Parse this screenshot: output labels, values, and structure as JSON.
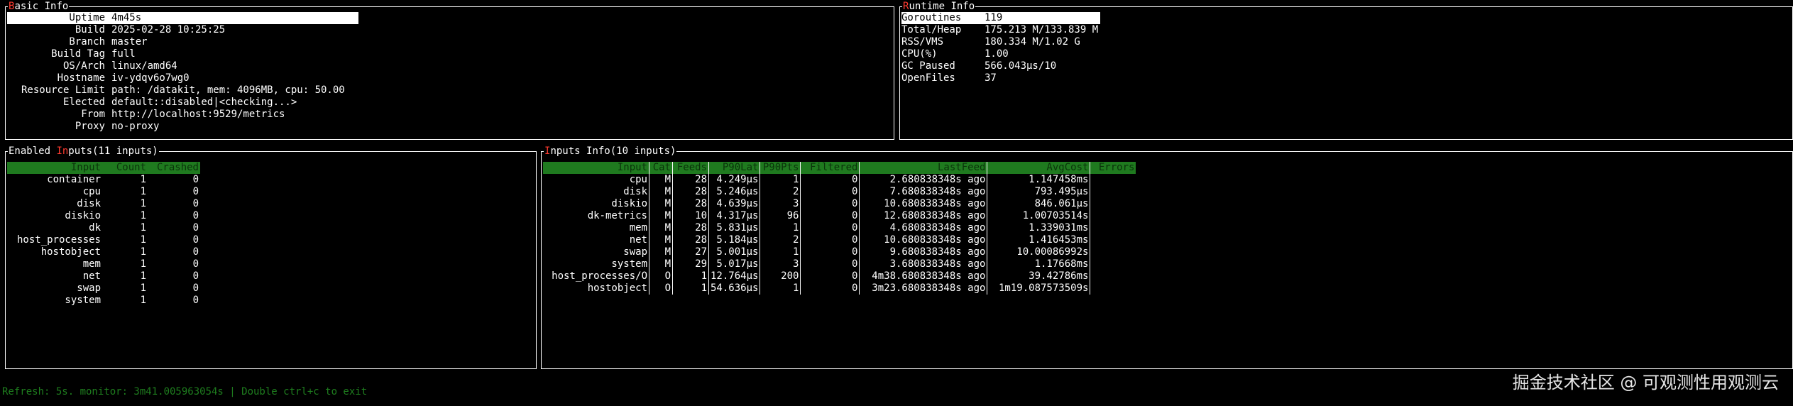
{
  "basic_info": {
    "title_hl": "B",
    "title_rest": "asic Info",
    "rows": [
      {
        "key": "Uptime",
        "value": "4m45s"
      },
      {
        "key": "Build",
        "value": "2025-02-28 10:25:25"
      },
      {
        "key": "Branch",
        "value": "master"
      },
      {
        "key": "Build Tag",
        "value": "full"
      },
      {
        "key": "OS/Arch",
        "value": "linux/amd64"
      },
      {
        "key": "Hostname",
        "value": "iv-ydqv6o7wg0"
      },
      {
        "key": "Resource Limit",
        "value": "path: /datakit, mem: 4096MB, cpu: 50.00"
      },
      {
        "key": "Elected",
        "value": "default::disabled|<checking...>"
      },
      {
        "key": "From",
        "value": "http://localhost:9529/metrics"
      },
      {
        "key": "Proxy",
        "value": "no-proxy"
      }
    ]
  },
  "runtime_info": {
    "title_hl": "R",
    "title_rest": "untime Info",
    "rows": [
      {
        "key": "Goroutines",
        "value": "119"
      },
      {
        "key": "Total/Heap",
        "value": "175.213 M/133.839 M"
      },
      {
        "key": "RSS/VMS",
        "value": "180.334 M/1.02 G"
      },
      {
        "key": "CPU(%)",
        "value": "1.00"
      },
      {
        "key": "GC Paused",
        "value": "566.043µs/10"
      },
      {
        "key": "OpenFiles",
        "value": "37"
      }
    ]
  },
  "enabled_inputs": {
    "title_a": "Enabled ",
    "title_hl": "In",
    "title_b": "puts(11 inputs)",
    "headers": [
      "Input",
      "Count",
      "Crashed"
    ],
    "rows": [
      [
        "container",
        "1",
        "0"
      ],
      [
        "cpu",
        "1",
        "0"
      ],
      [
        "disk",
        "1",
        "0"
      ],
      [
        "diskio",
        "1",
        "0"
      ],
      [
        "dk",
        "1",
        "0"
      ],
      [
        "host_processes",
        "1",
        "0"
      ],
      [
        "hostobject",
        "1",
        "0"
      ],
      [
        "mem",
        "1",
        "0"
      ],
      [
        "net",
        "1",
        "0"
      ],
      [
        "swap",
        "1",
        "0"
      ],
      [
        "system",
        "1",
        "0"
      ]
    ]
  },
  "inputs_info": {
    "title_hl": "I",
    "title_rest": "nputs Info(10 inputs)",
    "headers": [
      "Input",
      "Cat",
      "Feeds",
      "P90Lat",
      "P90Pts",
      "Filtered",
      "LastFeed",
      "AvgCost",
      "Errors"
    ],
    "rows": [
      [
        "cpu",
        "M",
        "28",
        "4.249µs",
        "1",
        "0",
        "2.680838348s ago",
        "1.147458ms",
        ""
      ],
      [
        "disk",
        "M",
        "28",
        "5.246µs",
        "2",
        "0",
        "7.680838348s ago",
        "793.495µs",
        ""
      ],
      [
        "diskio",
        "M",
        "28",
        "4.639µs",
        "3",
        "0",
        "10.680838348s ago",
        "846.061µs",
        ""
      ],
      [
        "dk-metrics",
        "M",
        "10",
        "4.317µs",
        "96",
        "0",
        "12.680838348s ago",
        "1.00703514s",
        ""
      ],
      [
        "mem",
        "M",
        "28",
        "5.831µs",
        "1",
        "0",
        "4.680838348s ago",
        "1.339031ms",
        ""
      ],
      [
        "net",
        "M",
        "28",
        "5.184µs",
        "2",
        "0",
        "10.680838348s ago",
        "1.416453ms",
        ""
      ],
      [
        "swap",
        "M",
        "27",
        "5.001µs",
        "1",
        "0",
        "9.680838348s ago",
        "10.00086992s",
        ""
      ],
      [
        "system",
        "M",
        "29",
        "5.017µs",
        "3",
        "0",
        "3.680838348s ago",
        "1.17668ms",
        ""
      ],
      [
        "host_processes/O",
        "O",
        "1",
        "12.764µs",
        "200",
        "0",
        "4m38.680838348s ago",
        "39.42786ms",
        ""
      ],
      [
        "hostobject",
        "O",
        "1",
        "54.636µs",
        "1",
        "0",
        "3m23.680838348s ago",
        "1m19.087573509s",
        ""
      ]
    ]
  },
  "footer": "Refresh: 5s. monitor: 3m41.005963054s | Double ctrl+c to exit",
  "watermark": "掘金技术社区 @ 可观测性用观测云",
  "colors": {
    "header_bg": "#1f7a1f",
    "accent": "#ff3b30",
    "footer": "#1e7d1e"
  }
}
